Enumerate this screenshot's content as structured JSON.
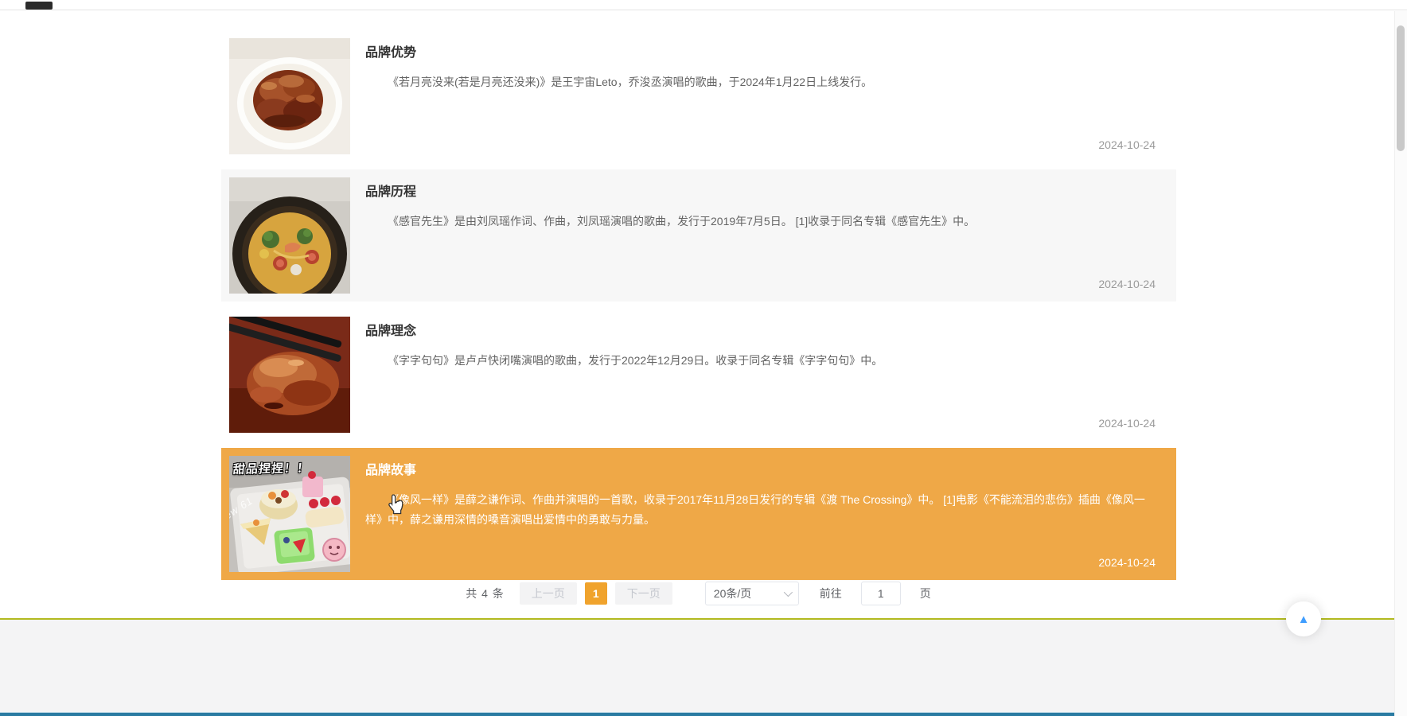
{
  "list": {
    "items": [
      {
        "title": "品牌优势",
        "summary": "《若月亮没来(若是月亮还没来)》是王宇宙Leto，乔浚丞演唱的歌曲，于2024年1月22日上线发行。",
        "date": "2024-10-24",
        "image": "braised-pork-on-plate"
      },
      {
        "title": "品牌历程",
        "summary": "《感官先生》是由刘凤瑶作词、作曲，刘凤瑶演唱的歌曲，发行于2019年7月5日。 [1]收录于同名专辑《感官先生》中。",
        "date": "2024-10-24",
        "image": "noodle-soup-bowl"
      },
      {
        "title": "品牌理念",
        "summary": "《字字句句》是卢卢快闭嘴演唱的歌曲，发行于2022年12月29日。收录于同名专辑《字字句句》中。",
        "date": "2024-10-24",
        "image": "roast-duck-with-chopsticks"
      },
      {
        "title": "品牌故事",
        "summary": "《像风一样》是薛之谦作词、作曲并演唱的一首歌，收录于2017年11月28日发行的专辑《渡 The Crossing》中。 [1]电影《不能流泪的悲伤》插曲《像风一样》中，薛之谦用深情的嗓音演唱出爱情中的勇敢与力量。",
        "date": "2024-10-24",
        "image": "dessert-tray",
        "highlighted": true
      }
    ]
  },
  "dessert_image": {
    "caption": "甜品捏捏！！",
    "watermark": "ew 61"
  },
  "pagination": {
    "total": "共 4 条",
    "prev": "上一页",
    "page_1": "1",
    "next": "下一页",
    "page_size": "20条/页",
    "goto_label": "前往",
    "goto_value": "1",
    "unit": "页"
  },
  "icons": {
    "caret_up": "▲"
  },
  "colors": {
    "highlight_row": "#EFA847",
    "pager_active": "#F0A32D",
    "divider_line": "#B2BA20",
    "bottom_bar": "#2A7BA2",
    "backtop_arrow": "#409EFF",
    "alt_row": "#F7F7F7",
    "date_text": "#9B9B9B"
  }
}
